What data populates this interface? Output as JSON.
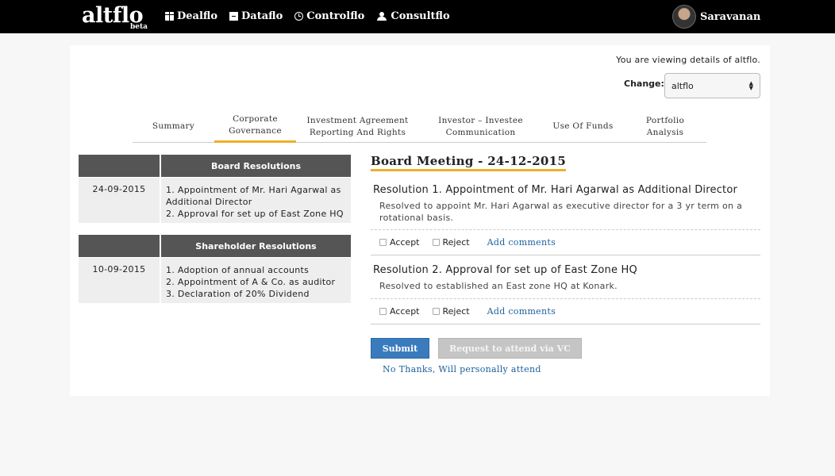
{
  "header": {
    "logo": "altflo",
    "logo_sub": "beta",
    "nav": [
      {
        "label": "Dealflo",
        "icon": "gift-icon"
      },
      {
        "label": "Dataflo",
        "icon": "archive-icon"
      },
      {
        "label": "Controlflo",
        "icon": "clock-icon"
      },
      {
        "label": "Consultflo",
        "icon": "users-icon"
      }
    ],
    "user_name": "Saravanan"
  },
  "viewing_text": "You are viewing details of altflo.",
  "change": {
    "label": "Change:",
    "selected": "altflo"
  },
  "tabs": [
    {
      "line1": "Summary",
      "line2": ""
    },
    {
      "line1": "Corporate",
      "line2": "Governance"
    },
    {
      "line1": "Investment Agreement",
      "line2": "Reporting And Rights"
    },
    {
      "line1": "Investor – Investee",
      "line2": "Communication"
    },
    {
      "line1": "Use Of Funds",
      "line2": ""
    },
    {
      "line1": "Portfolio",
      "line2": "Analysis"
    }
  ],
  "board_resolutions": {
    "title": "Board Resolutions",
    "date": "24-09-2015",
    "items": [
      "1. Appointment of Mr. Hari Agarwal as",
      "Additional Director",
      "2. Approval for set up of East Zone HQ"
    ]
  },
  "shareholder_resolutions": {
    "title": "Shareholder Resolutions",
    "date": "10-09-2015",
    "items": [
      "1. Adoption of annual accounts",
      "2. Appointment of A & Co. as auditor",
      "3. Declaration of 20% Dividend"
    ]
  },
  "meeting": {
    "title": "Board Meeting - 24-12-2015",
    "resolutions": [
      {
        "title": "Resolution 1. Appointment of Mr. Hari Agarwal as Additional Director",
        "desc_line1": "Resolved to appoint Mr. Hari Agarwal as executive director for a 3 yr term on a",
        "desc_line2": "rotational basis.",
        "accept": "Accept",
        "reject": "Reject",
        "comments": "Add comments"
      },
      {
        "title": "Resolution 2. Approval for set up of East Zone HQ",
        "desc_line1": "Resolved to established an East zone HQ at Konark.",
        "desc_line2": "",
        "accept": "Accept",
        "reject": "Reject",
        "comments": "Add comments"
      }
    ]
  },
  "actions": {
    "submit": "Submit",
    "request_vc": "Request to attend via VC",
    "no_thanks": "No Thanks, Will personally attend"
  },
  "colors": {
    "accent": "#f0ae2c",
    "primary": "#3a7bbd",
    "link": "#1a5f9b"
  }
}
